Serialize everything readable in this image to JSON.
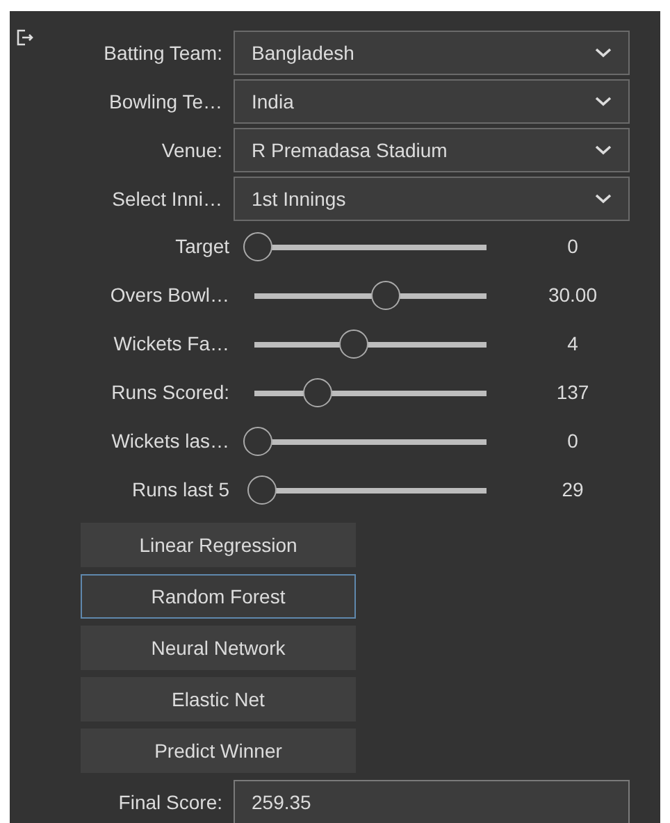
{
  "selects": [
    {
      "label": "Batting Team:",
      "value": "Bangladesh"
    },
    {
      "label": "Bowling Te…",
      "value": "India"
    },
    {
      "label": "Venue:",
      "value": "R Premadasa Stadium"
    },
    {
      "label": "Select Inni…",
      "value": "1st Innings"
    }
  ],
  "sliders": [
    {
      "label": "Target",
      "level": 0,
      "reading": "0"
    },
    {
      "label": "Overs Bowl…",
      "level": 0.6,
      "reading": "30.00"
    },
    {
      "label": "Wickets Fa…",
      "level": 0.45,
      "reading": "4"
    },
    {
      "label": "Runs Scored:",
      "level": 0.28,
      "reading": "137"
    },
    {
      "label": "Wickets las…",
      "level": 0,
      "reading": "0"
    },
    {
      "label": "Runs last 5",
      "level": 0.02,
      "reading": "29"
    }
  ],
  "buttons": [
    {
      "label": "Linear Regression",
      "selected": false
    },
    {
      "label": "Random Forest",
      "selected": true
    },
    {
      "label": "Neural Network",
      "selected": false
    },
    {
      "label": "Elastic Net",
      "selected": false
    },
    {
      "label": "Predict Winner",
      "selected": false
    }
  ],
  "result": {
    "label": "Final Score:",
    "value": "259.35"
  }
}
